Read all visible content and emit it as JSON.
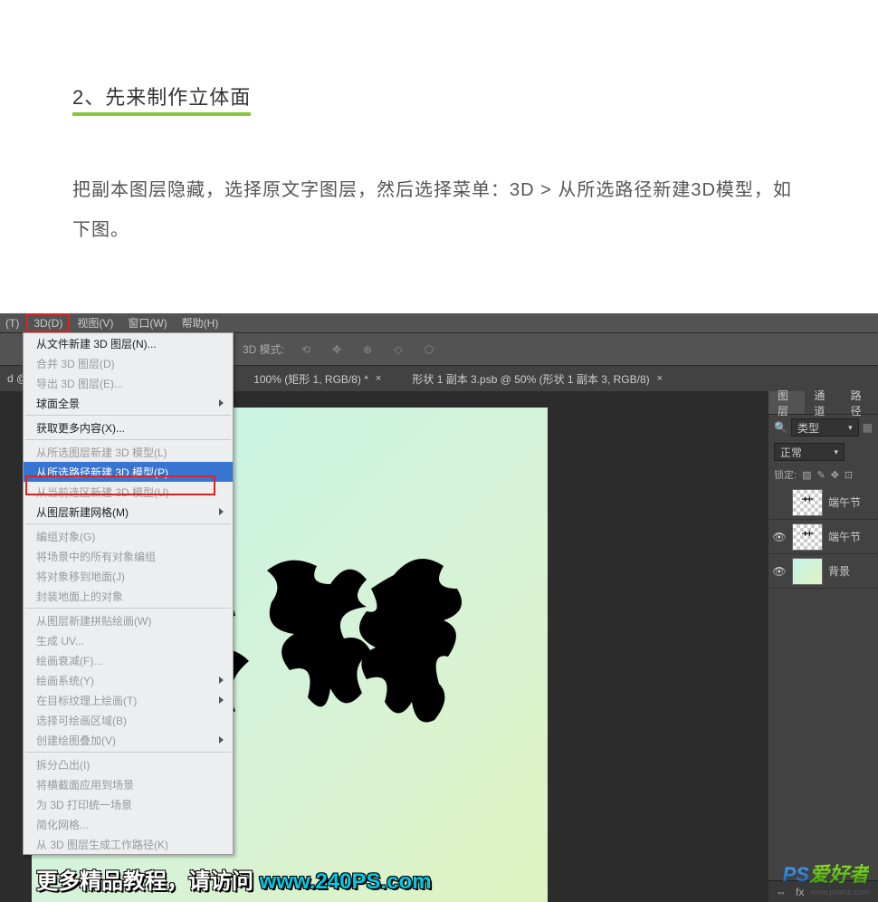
{
  "article": {
    "heading": "2、先来制作立体面",
    "body": "把副本图层隐藏，选择原文字图层，然后选择菜单：3D > 从所选路径新建3D模型，如下图。"
  },
  "menubar": {
    "t": "(T)",
    "threeD": "3D(D)",
    "view": "视图(V)",
    "window": "窗口(W)",
    "help": "帮助(H)"
  },
  "dropdown": {
    "items": [
      {
        "label": "从文件新建 3D 图层(N)...",
        "disabled": false,
        "sub": false
      },
      {
        "label": "合并 3D 图层(D)",
        "disabled": true,
        "sub": false
      },
      {
        "label": "导出 3D 图层(E)...",
        "disabled": true,
        "sub": false
      },
      {
        "label": "球面全景",
        "disabled": false,
        "sub": true
      },
      {
        "sep": true
      },
      {
        "label": "获取更多内容(X)...",
        "disabled": false,
        "sub": false
      },
      {
        "sep": true
      },
      {
        "label": "从所选图层新建 3D 模型(L)",
        "disabled": true,
        "sub": false
      },
      {
        "label": "从所选路径新建 3D 模型(P)",
        "disabled": false,
        "sub": false,
        "hl": true
      },
      {
        "label": "从当前选区新建 3D 模型(U)",
        "disabled": true,
        "sub": false
      },
      {
        "label": "从图层新建网格(M)",
        "disabled": false,
        "sub": true
      },
      {
        "sep": true
      },
      {
        "label": "编组对象(G)",
        "disabled": true,
        "sub": false
      },
      {
        "label": "将场景中的所有对象编组",
        "disabled": true,
        "sub": false
      },
      {
        "label": "将对象移到地面(J)",
        "disabled": true,
        "sub": false
      },
      {
        "label": "封装地面上的对象",
        "disabled": true,
        "sub": false
      },
      {
        "sep": true
      },
      {
        "label": "从图层新建拼贴绘画(W)",
        "disabled": true,
        "sub": false
      },
      {
        "label": "生成 UV...",
        "disabled": true,
        "sub": false
      },
      {
        "label": "绘画衰减(F)...",
        "disabled": true,
        "sub": false
      },
      {
        "label": "绘画系统(Y)",
        "disabled": true,
        "sub": true
      },
      {
        "label": "在目标纹理上绘画(T)",
        "disabled": true,
        "sub": true
      },
      {
        "label": "选择可绘画区域(B)",
        "disabled": true,
        "sub": false
      },
      {
        "label": "创建绘图叠加(V)",
        "disabled": true,
        "sub": true
      },
      {
        "sep": true
      },
      {
        "label": "拆分凸出(I)",
        "disabled": true,
        "sub": false
      },
      {
        "label": "将横截面应用到场景",
        "disabled": true,
        "sub": false
      },
      {
        "label": "为 3D 打印统一场景",
        "disabled": true,
        "sub": false
      },
      {
        "label": "简化网格...",
        "disabled": true,
        "sub": false
      },
      {
        "label": "从 3D 图层生成工作路径(K)",
        "disabled": true,
        "sub": false
      }
    ]
  },
  "optionsBar": {
    "label": "3D 模式:"
  },
  "tabbar": {
    "docLabel": "d @",
    "tab1": "100% (矩形 1, RGB/8) *",
    "tab2": "形状 1 副本 3.psb @ 50% (形状 1 副本 3, RGB/8)"
  },
  "panels": {
    "layersTab": "图层",
    "channelsTab": "通道",
    "pathsTab": "路径",
    "filterLabel": "类型",
    "blendMode": "正常",
    "lockLabel": "锁定:"
  },
  "layers": [
    {
      "name": "端午节",
      "visible": false,
      "thumb": "tx"
    },
    {
      "name": "端午节",
      "visible": true,
      "thumb": "tx"
    },
    {
      "name": "背景",
      "visible": true,
      "thumb": "bg"
    }
  ],
  "panelBottom": {
    "fx": "fx"
  },
  "watermark": {
    "text": "更多精品教程，请访问 ",
    "url": "www.240PS.com",
    "logo_ps": "PS",
    "logo_cn": "爱好者",
    "logo_sub": "www.psahz.com"
  }
}
